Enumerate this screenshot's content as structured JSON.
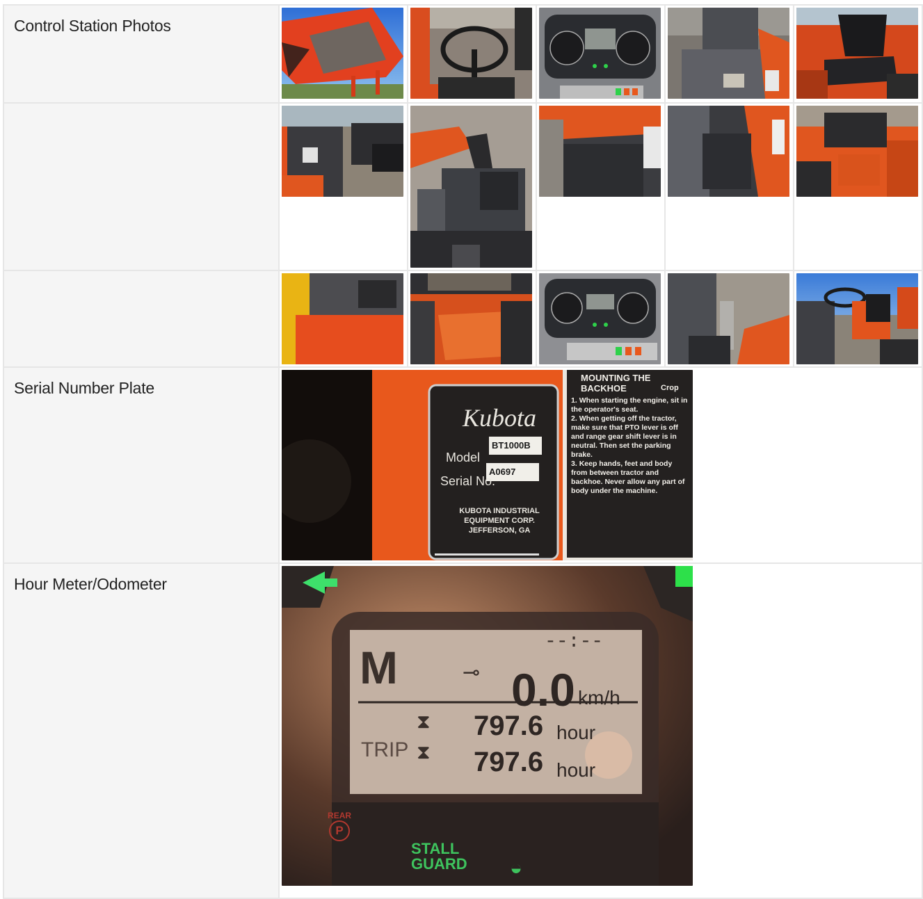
{
  "rows": [
    {
      "label": "Control Station Photos"
    },
    {
      "label": ""
    },
    {
      "label": ""
    },
    {
      "label": "Serial Number Plate"
    },
    {
      "label": "Hour Meter/Odometer"
    }
  ],
  "serial_plate": {
    "brand": "Kubota",
    "model_label": "Model",
    "model_value": "BT1000B",
    "serial_label": "Serial No.",
    "serial_value": "A0697",
    "maker_line1": "KUBOTA INDUSTRIAL",
    "maker_line2": "EQUIPMENT CORP.",
    "maker_line3": "JEFFERSON, GA",
    "warning_title": "MOUNTING THE BACKHOE",
    "crop_label": "Crop",
    "warning_items": [
      "1. When starting the engine, sit in the operator's seat.",
      "2. When getting off the tractor, make sure that PTO lever is off and range gear shift lever is in neutral. Then set the parking brake.",
      "3. Keep hands, feet and body from between tractor and backhoe. Never allow any part of body under the machine."
    ]
  },
  "meter": {
    "mode": "M",
    "time": "--:--",
    "speed": "0.0",
    "speed_unit": "km/h",
    "hours": "797.6",
    "hours_unit": "hour",
    "trip_label": "TRIP",
    "trip_hours": "797.6",
    "trip_unit": "hour",
    "rear_label": "REAR",
    "parking_glyph": "P",
    "stall_line1": "STALL",
    "stall_line2": "GUARD"
  },
  "colors": {
    "kubota_orange": "#e8581c",
    "label_bg": "#f5f5f5",
    "grid_line": "#e6e6e6"
  }
}
